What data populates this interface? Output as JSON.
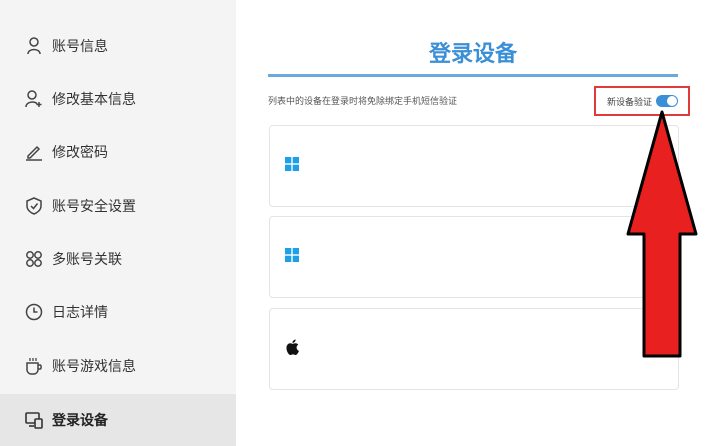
{
  "sidebar": {
    "items": [
      {
        "label": "账号信息",
        "icon": "user-icon"
      },
      {
        "label": "修改基本信息",
        "icon": "user-edit-icon"
      },
      {
        "label": "修改密码",
        "icon": "pencil-icon"
      },
      {
        "label": "账号安全设置",
        "icon": "shield-check-icon"
      },
      {
        "label": "多账号关联",
        "icon": "multi-account-icon"
      },
      {
        "label": "日志详情",
        "icon": "clock-icon"
      },
      {
        "label": "账号游戏信息",
        "icon": "game-cup-icon"
      },
      {
        "label": "登录设备",
        "icon": "devices-icon",
        "active": true
      }
    ]
  },
  "main": {
    "title": "登录设备",
    "hint": "列表中的设备在登录时将免除绑定手机短信验证",
    "new_device_verify_label": "新设备验证",
    "new_device_verify_on": true,
    "devices": [
      {
        "icon": "windows-icon"
      },
      {
        "icon": "windows-icon"
      },
      {
        "icon": "apple-icon"
      }
    ]
  },
  "colors": {
    "accent": "#3a8fd6",
    "highlight_box": "#e23a3a",
    "annotation_arrow": "#e8201f"
  }
}
